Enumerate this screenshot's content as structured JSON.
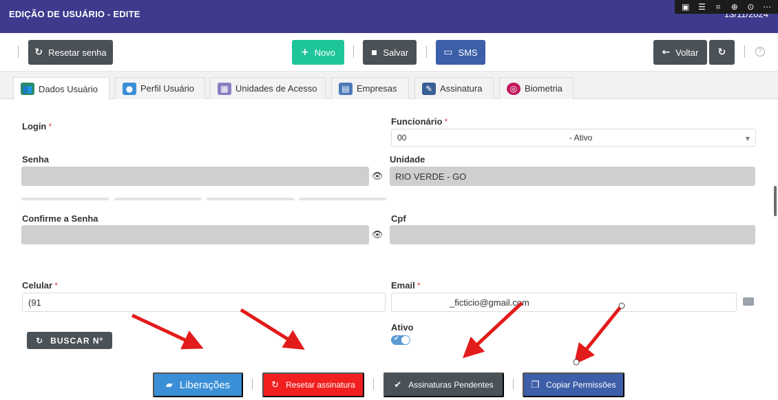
{
  "header": {
    "title": "EDIÇÃO DE USUÁRIO - EDITE",
    "date": "13/11/2024"
  },
  "system_tools": [
    "comment-icon",
    "text-icon",
    "crop-icon",
    "zoom-icon",
    "plus-circle-icon",
    "more-icon"
  ],
  "toolbar": {
    "reset_password_label": "Resetar senha",
    "new_label": "Novo",
    "save_label": "Salvar",
    "sms_label": "SMS",
    "back_label": "Voltar",
    "help_label": "?",
    "colors": {
      "dark": "#4a5157",
      "green": "#1fc59a",
      "blue": "#3d5ea8"
    }
  },
  "tabs": [
    {
      "label": "Dados Usuário",
      "icon": "users-icon"
    },
    {
      "label": "Perfil Usuário",
      "icon": "user-icon"
    },
    {
      "label": "Unidades de Acesso",
      "icon": "building-icon"
    },
    {
      "label": "Empresas",
      "icon": "company-icon"
    },
    {
      "label": "Assinatura",
      "icon": "pen-icon"
    },
    {
      "label": "Biometria",
      "icon": "fingerprint-icon"
    }
  ],
  "form": {
    "login": {
      "label": "Login",
      "required_mark": "*"
    },
    "funcionario": {
      "label": "Funcionário",
      "required_mark": "*",
      "value_prefix": "00",
      "value_suffix": "- Ativo"
    },
    "senha": {
      "label": "Senha"
    },
    "unidade": {
      "label": "Unidade",
      "value": "RIO VERDE - GO"
    },
    "confirme_senha": {
      "label": "Confirme a Senha"
    },
    "cpf": {
      "label": "Cpf"
    },
    "celular": {
      "label": "Celular",
      "required_mark": "*",
      "value": "(91"
    },
    "email": {
      "label": "Email",
      "required_mark": "*",
      "value": "_ficticio@gmail.com"
    },
    "ativo": {
      "label": "Ativo",
      "checked": true
    }
  },
  "buscar_label": "BUSCAR Nº",
  "bottom_buttons": {
    "liberacoes": "Liberações",
    "resetar_assinatura": "Resetar assinatura",
    "assinaturas_pendentes": "Assinaturas Pendentes",
    "copiar_permissoes": "Copiar Permissões",
    "colors": {
      "liberacoes": "#3a8fd6",
      "resetar": "#f11f1f",
      "pendentes": "#4a5157",
      "copiar": "#3d5ea8"
    }
  },
  "annotation_color": "#e21b1b"
}
